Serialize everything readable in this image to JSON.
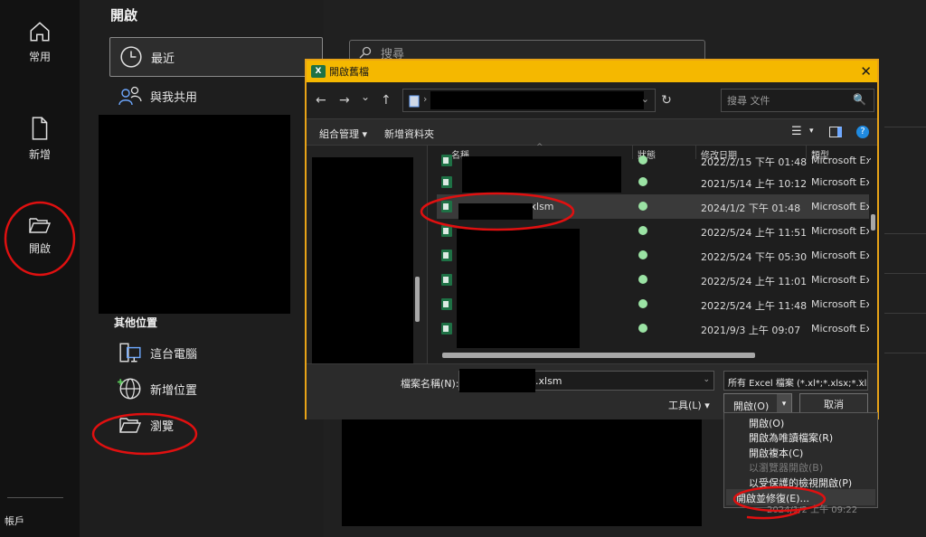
{
  "rail": {
    "items": [
      {
        "label": "常用",
        "icon": "home-icon"
      },
      {
        "label": "新增",
        "icon": "new-file-icon"
      },
      {
        "label": "開啟",
        "icon": "open-folder-icon"
      }
    ],
    "account_label": "帳戶"
  },
  "panel": {
    "title": "開啟",
    "recent_label": "最近",
    "shared_label": "與我共用",
    "other_places_title": "其他位置",
    "this_pc_label": "這台電腦",
    "add_place_label": "新增位置",
    "browse_label": "瀏覽"
  },
  "search": {
    "placeholder": "搜尋"
  },
  "dialog": {
    "title": "開啟舊檔",
    "close_glyph": "✕",
    "back_glyph": "←",
    "forward_glyph": "→",
    "recent_glyph": "⌄",
    "up_glyph": "↑",
    "path_sep": "›",
    "path_dd": "⌄",
    "refresh_glyph": "↻",
    "search_placeholder": "搜尋 文件",
    "search_glyph": "🔍",
    "toolbar": {
      "organize_label": "組合管理 ▾",
      "new_folder_label": "新增資料夾",
      "view_glyph": "☰",
      "view_dd": "▾",
      "help_glyph": "?"
    },
    "columns": {
      "name": "名稱",
      "status": "狀態",
      "modified": "修改日期",
      "type": "類型"
    },
    "rows": [
      {
        "name": "",
        "modified": "2022/2/15 下午 01:48",
        "type": "Microsoft Excel"
      },
      {
        "name": "",
        "modified": "2021/5/14 上午 10:12",
        "type": "Microsoft Excel"
      },
      {
        "name": "xlsm",
        "modified": "2024/1/2 下午 01:48",
        "type": "Microsoft Excel"
      },
      {
        "name": "",
        "modified": "2022/5/24 上午 11:51",
        "type": "Microsoft Excel"
      },
      {
        "name": "",
        "modified": "2022/5/24 下午 05:30",
        "type": "Microsoft Excel"
      },
      {
        "name": "",
        "modified": "2022/5/24 上午 11:01",
        "type": "Microsoft Excel"
      },
      {
        "name": "",
        "modified": "2022/5/24 上午 11:48",
        "type": "Microsoft Excel"
      },
      {
        "name": "",
        "modified": "2021/9/3 上午 09:07",
        "type": "Microsoft Excel"
      }
    ],
    "filename_label": "檔案名稱(N):",
    "filename_ext": "xlsm",
    "filetype_label": "所有 Excel 檔案 (*.xl*;*.xlsx;*.xls",
    "dd_glyph": "⌄",
    "tools_label": "工具(L)  ▾",
    "open_label": "開啟(O)",
    "open_dd": "▾",
    "cancel_label": "取消"
  },
  "open_menu": {
    "items": [
      {
        "label": "開啟(O)",
        "enabled": true
      },
      {
        "label": "開啟為唯讀檔案(R)",
        "enabled": true
      },
      {
        "label": "開啟複本(C)",
        "enabled": true
      },
      {
        "label": "以瀏覽器開啟(B)",
        "enabled": false
      },
      {
        "label": "以受保護的檢視開啟(P)",
        "enabled": true
      },
      {
        "label": "開啟並修復(E)...",
        "enabled": true
      }
    ],
    "partial_text": "2024/1/2 上午 09:22"
  },
  "colors": {
    "dialog_accent": "#f5b800",
    "annotation_red": "#e01010",
    "excel_green": "#1e7145"
  }
}
